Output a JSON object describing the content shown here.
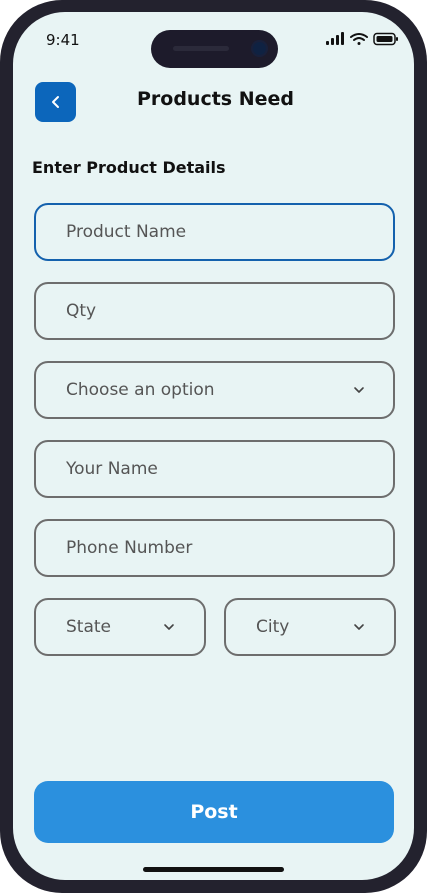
{
  "status": {
    "time": "9:41"
  },
  "header": {
    "title": "Products Need"
  },
  "form": {
    "section_title": "Enter Product Details",
    "product_name": {
      "placeholder": "Product Name"
    },
    "qty": {
      "placeholder": "Qty"
    },
    "category": {
      "selected": "Choose an option"
    },
    "your_name": {
      "placeholder": "Your Name"
    },
    "phone": {
      "placeholder": "Phone Number"
    },
    "state": {
      "selected": "State"
    },
    "city": {
      "selected": "City"
    }
  },
  "actions": {
    "post_label": "Post"
  },
  "icons": [
    "back-chevron-icon",
    "signal-icon",
    "wifi-icon",
    "battery-icon",
    "chevron-down-icon"
  ],
  "colors": {
    "accent": "#0c66bb",
    "button": "#2b90de",
    "background": "#e8f4f4",
    "active_border": "#1461ad"
  }
}
